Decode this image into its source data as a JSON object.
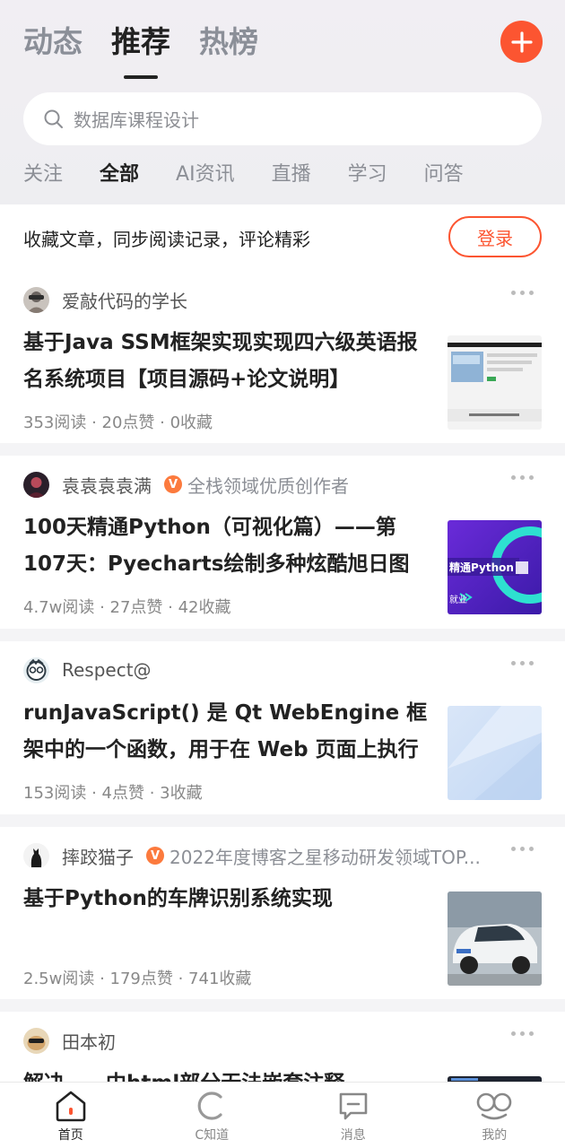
{
  "header": {
    "tabs": [
      {
        "label": "动态",
        "active": false
      },
      {
        "label": "推荐",
        "active": true
      },
      {
        "label": "热榜",
        "active": false
      }
    ],
    "add_icon": "plus-icon",
    "accent_color": "#fc5531"
  },
  "search": {
    "placeholder": "数据库课程设计",
    "icon": "search-icon"
  },
  "sub_tabs": [
    {
      "label": "关注",
      "active": false
    },
    {
      "label": "全部",
      "active": true
    },
    {
      "label": "AI资讯",
      "active": false
    },
    {
      "label": "直播",
      "active": false
    },
    {
      "label": "学习",
      "active": false
    },
    {
      "label": "问答",
      "active": false
    }
  ],
  "login_bar": {
    "text": "收藏文章，同步阅读记录，评论精彩",
    "button": "登录"
  },
  "feed": [
    {
      "author": "爱敲代码的学长",
      "badge": "",
      "title": "基于Java SSM框架实现实现四六级英语报名系统项目【项目源码+论文说明】",
      "meta": "353阅读 · 20点赞 · 0收藏"
    },
    {
      "author": "袁袁袁袁满",
      "badge": "全栈领域优质创作者",
      "title": "100天精通Python（可视化篇）——第107天：Pyecharts绘制多种炫酷旭日图",
      "meta": "4.7w阅读 · 27点赞 · 42收藏",
      "thumb_text": "精通Python",
      "thumb_subtext": "就业"
    },
    {
      "author": "Respect@",
      "badge": "",
      "title": "runJavaScript() 是 Qt WebEngine 框架中的一个函数，用于在 Web 页面上执行",
      "meta": "153阅读 · 4点赞 · 3收藏"
    },
    {
      "author": "摔跤猫子",
      "badge": "2022年度博客之星移动研发领域TOP...",
      "title": "基于Python的车牌识别系统实现",
      "meta": "2.5w阅读 · 179点赞 · 741收藏"
    },
    {
      "author": "田本初",
      "badge": "",
      "title": "解决……中html部分无法嵌套注释",
      "meta": ""
    }
  ],
  "tabbar": [
    {
      "label": "首页",
      "icon": "home-icon",
      "active": true
    },
    {
      "label": "C知道",
      "icon": "c-know-icon",
      "active": false
    },
    {
      "label": "消息",
      "icon": "message-icon",
      "active": false
    },
    {
      "label": "我的",
      "icon": "profile-icon",
      "active": false
    }
  ]
}
